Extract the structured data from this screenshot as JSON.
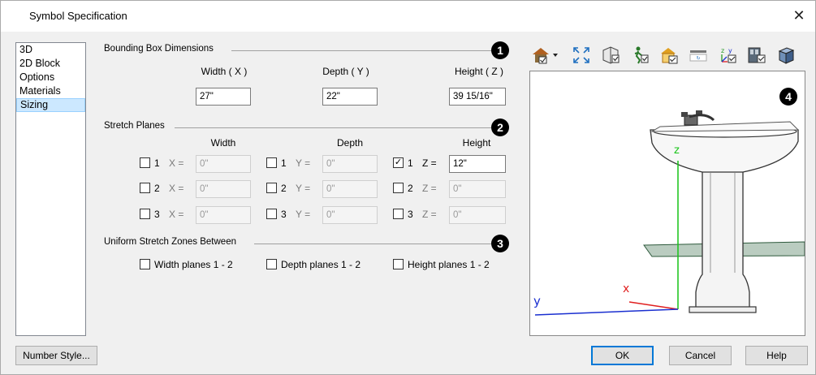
{
  "window": {
    "title": "Symbol Specification",
    "close_glyph": "✕"
  },
  "sidebar": {
    "items": [
      "3D",
      "2D Block",
      "Options",
      "Materials",
      "Sizing"
    ],
    "selected": "Sizing"
  },
  "bounding": {
    "label": "Bounding Box Dimensions",
    "badge": "1",
    "width_label": "Width ( X )",
    "depth_label": "Depth ( Y )",
    "height_label": "Height ( Z )",
    "width_value": "27\"",
    "depth_value": "22\"",
    "height_value": "39 15/16\""
  },
  "stretch": {
    "label": "Stretch Planes",
    "badge": "2",
    "width_head": "Width",
    "depth_head": "Depth",
    "height_head": "Height",
    "width": [
      {
        "num": "1",
        "axis": "X =",
        "value": "0\"",
        "checked": false
      },
      {
        "num": "2",
        "axis": "X =",
        "value": "0\"",
        "checked": false
      },
      {
        "num": "3",
        "axis": "X =",
        "value": "0\"",
        "checked": false
      }
    ],
    "depth": [
      {
        "num": "1",
        "axis": "Y =",
        "value": "0\"",
        "checked": false
      },
      {
        "num": "2",
        "axis": "Y =",
        "value": "0\"",
        "checked": false
      },
      {
        "num": "3",
        "axis": "Y =",
        "value": "0\"",
        "checked": false
      }
    ],
    "height": [
      {
        "num": "1",
        "axis": "Z =",
        "value": "12\"",
        "checked": true
      },
      {
        "num": "2",
        "axis": "Z =",
        "value": "0\"",
        "checked": false
      },
      {
        "num": "3",
        "axis": "Z =",
        "value": "0\"",
        "checked": false
      }
    ]
  },
  "uniform": {
    "label": "Uniform Stretch Zones Between",
    "badge": "3",
    "width_label": "Width planes 1 - 2",
    "depth_label": "Depth planes 1 - 2",
    "height_label": "Height planes 1 - 2"
  },
  "preview": {
    "badge": "4",
    "axis_x": "x",
    "axis_y": "y",
    "axis_z": "z",
    "icons": [
      "home-view-dropdown-icon",
      "fill-window-icon",
      "walls-icon",
      "stretch-planes-icon",
      "bounding-box-icon",
      "plane-icon",
      "axes-icon",
      "color-icon",
      "cube-icon"
    ]
  },
  "buttons": {
    "number_style": "Number Style...",
    "ok": "OK",
    "cancel": "Cancel",
    "help": "Help"
  },
  "colors": {
    "accent": "#0078d7",
    "selection": "#cce8ff",
    "axis_x": "#e02020",
    "axis_y": "#1a2fd0",
    "axis_z": "#17c417",
    "plane": "#3a6e4a"
  }
}
